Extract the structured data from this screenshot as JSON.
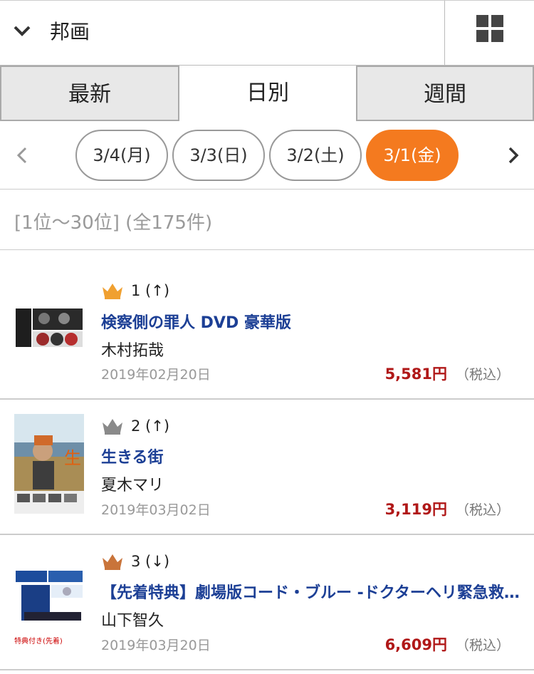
{
  "genre": {
    "label": "邦画"
  },
  "tabs": [
    {
      "label": "最新"
    },
    {
      "label": "日別"
    },
    {
      "label": "週間"
    }
  ],
  "dates": [
    {
      "label": "3/4(月)"
    },
    {
      "label": "3/3(日)"
    },
    {
      "label": "3/2(土)"
    },
    {
      "label": "3/1(金)"
    }
  ],
  "range_text": "[1位〜30位] (全175件)",
  "items": [
    {
      "rank": "1 (↑)",
      "crown": "gold",
      "title": "検察側の罪人 DVD 豪華版",
      "artist": "木村拓哉",
      "date": "2019年02月20日",
      "price": "5,581円",
      "tax": "（税込）"
    },
    {
      "rank": "2 (↑)",
      "crown": "silver",
      "title": "生きる街",
      "artist": "夏木マリ",
      "date": "2019年03月02日",
      "price": "3,119円",
      "tax": "（税込）"
    },
    {
      "rank": "3 (↓)",
      "crown": "bronze",
      "title": "【先着特典】劇場版コード・ブルー -ドクターヘリ緊急救命-",
      "artist": "山下智久",
      "date": "2019年03月20日",
      "price": "6,609円",
      "tax": "（税込）",
      "thumb_badge": "特典付き(先着)"
    }
  ],
  "colors": {
    "accent": "#f47a1f",
    "title": "#1c3f95",
    "price": "#b01818",
    "crown_gold": "#f0a030",
    "crown_silver": "#8a8a8a",
    "crown_bronze": "#c9743a"
  }
}
